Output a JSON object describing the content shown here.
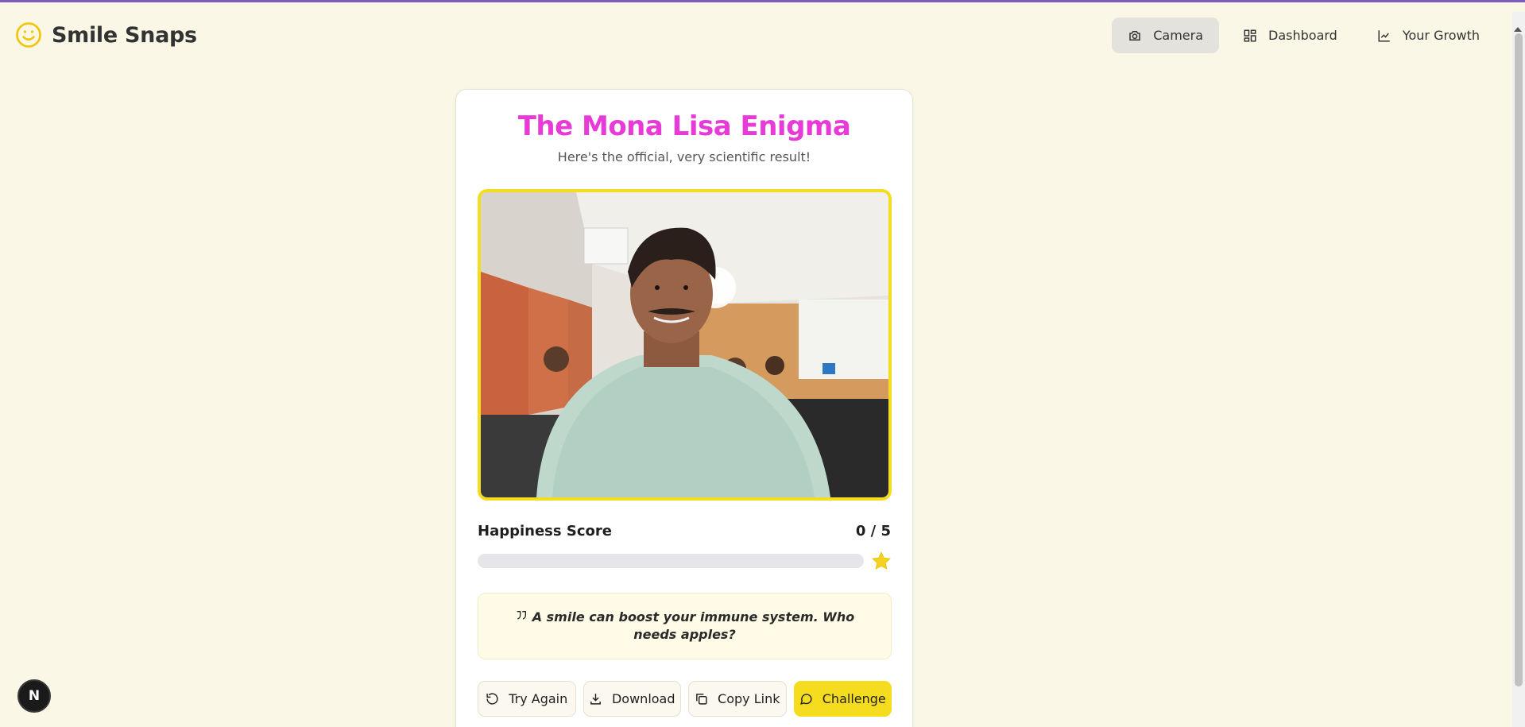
{
  "app": {
    "name": "Smile Snaps",
    "logo_icon": "smiley-icon",
    "accent_color": "#f4dd1f",
    "title_color": "#e83ad6"
  },
  "nav": {
    "items": [
      {
        "label": "Camera",
        "icon": "camera-icon",
        "active": true
      },
      {
        "label": "Dashboard",
        "icon": "dashboard-grid-icon",
        "active": false
      },
      {
        "label": "Your Growth",
        "icon": "chart-line-icon",
        "active": false
      }
    ]
  },
  "result": {
    "title": "The Mona Lisa Enigma",
    "subtitle": "Here's the official, very scientific result!",
    "score_label": "Happiness Score",
    "score_value": "0 / 5",
    "score_fraction": 0,
    "quote": "A smile can boost your immune system. Who needs apples?"
  },
  "actions": {
    "try_again": "Try Again",
    "download": "Download",
    "copy_link": "Copy Link",
    "challenge": "Challenge"
  },
  "dev_badge": "N"
}
